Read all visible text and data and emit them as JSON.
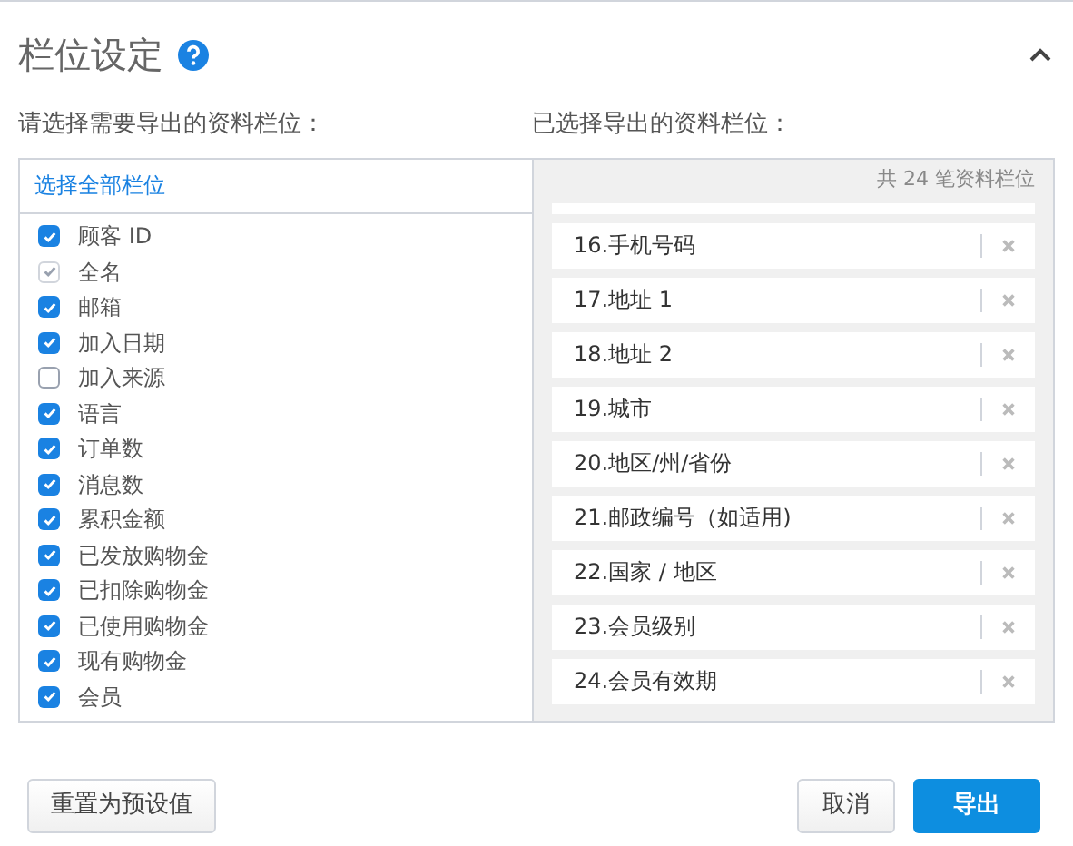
{
  "header": {
    "title": "栏位设定",
    "expanded": true
  },
  "available": {
    "label": "请选择需要导出的资料栏位：",
    "select_all": "选择全部栏位",
    "fields": [
      {
        "label": "顾客 ID",
        "checked": true,
        "disabled": false
      },
      {
        "label": "全名",
        "checked": true,
        "disabled": true
      },
      {
        "label": "邮箱",
        "checked": true,
        "disabled": false
      },
      {
        "label": "加入日期",
        "checked": true,
        "disabled": false
      },
      {
        "label": "加入来源",
        "checked": false,
        "disabled": false
      },
      {
        "label": "语言",
        "checked": true,
        "disabled": false
      },
      {
        "label": "订单数",
        "checked": true,
        "disabled": false
      },
      {
        "label": "消息数",
        "checked": true,
        "disabled": false
      },
      {
        "label": "累积金额",
        "checked": true,
        "disabled": false
      },
      {
        "label": "已发放购物金",
        "checked": true,
        "disabled": false
      },
      {
        "label": "已扣除购物金",
        "checked": true,
        "disabled": false
      },
      {
        "label": "已使用购物金",
        "checked": true,
        "disabled": false
      },
      {
        "label": "现有购物金",
        "checked": true,
        "disabled": false
      },
      {
        "label": "会员",
        "checked": true,
        "disabled": false
      }
    ]
  },
  "selected": {
    "label": "已选择导出的资料栏位：",
    "count": "共 24 笔资料栏位",
    "items": [
      "16.手机号码",
      "17.地址 1",
      "18.地址 2",
      "19.城市",
      "20.地区/州/省份",
      "21.邮政编号（如适用)",
      "22.国家 / 地区",
      "23.会员级别",
      "24.会员有效期"
    ]
  },
  "buttons": {
    "reset": "重置为预设值",
    "cancel": "取消",
    "export": "导出"
  }
}
